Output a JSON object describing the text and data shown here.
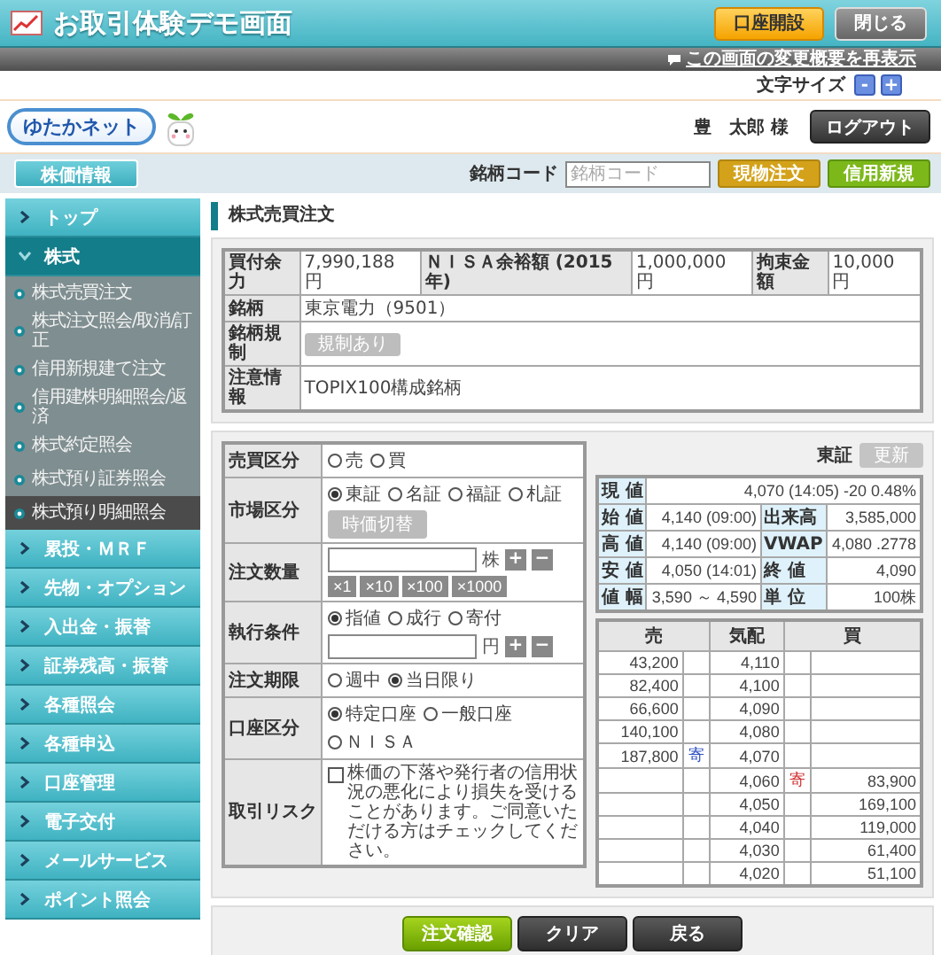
{
  "window": {
    "title": "お取引体験デモ画面",
    "buttons": [
      {
        "label": "口座開設",
        "kind": "primary"
      },
      {
        "label": "閉じる",
        "kind": "secondary"
      }
    ]
  },
  "notice_bar": {
    "link": "この画面の変更概要を再表示"
  },
  "font_size": {
    "label": "文字サイズ",
    "buttons": [
      "-",
      "+"
    ]
  },
  "header": {
    "logo": "ゆたかネット",
    "user": "豊　太郎",
    "honorific": "様",
    "logout": "ログアウト"
  },
  "toolbar": {
    "stock_info": "株価情報",
    "code_label": "銘柄コード",
    "code_placeholder": "銘柄コード",
    "buttons": [
      {
        "label": "現物注文",
        "kind": "spot"
      },
      {
        "label": "信用新規",
        "kind": "margin"
      }
    ]
  },
  "sidebar": {
    "items": [
      {
        "label": "トップ",
        "expanded": false
      },
      {
        "label": "株式",
        "expanded": true,
        "children": [
          {
            "label": "株式売買注文",
            "selected": false
          },
          {
            "label": "株式注文照会/取消/訂正",
            "selected": false
          },
          {
            "label": "信用新規建て注文",
            "selected": false
          },
          {
            "label": "信用建株明細照会/返済",
            "selected": false
          },
          {
            "label": "株式約定照会",
            "selected": false
          },
          {
            "label": "株式預り証券照会",
            "selected": false
          },
          {
            "label": "株式預り明細照会",
            "selected": true
          }
        ]
      },
      {
        "label": "累投・ＭＲＦ",
        "expanded": false
      },
      {
        "label": "先物・オプション",
        "expanded": false
      },
      {
        "label": "入出金・振替",
        "expanded": false
      },
      {
        "label": "証券残高・振替",
        "expanded": false
      },
      {
        "label": "各種照会",
        "expanded": false
      },
      {
        "label": "各種申込",
        "expanded": false
      },
      {
        "label": "口座管理",
        "expanded": false
      },
      {
        "label": "電子交付",
        "expanded": false
      },
      {
        "label": "メールサービス",
        "expanded": false
      },
      {
        "label": "ポイント照会",
        "expanded": false
      }
    ]
  },
  "main": {
    "heading": "株式売買注文",
    "account": {
      "cells": [
        {
          "label": "買付余力",
          "value": "7,990,188 円"
        },
        {
          "label": "ＮＩＳＡ余裕額 (2015年)",
          "value": "1,000,000 円"
        },
        {
          "label": "拘束金額",
          "value": "10,000 円"
        }
      ],
      "rows": [
        {
          "label": "銘柄",
          "kind": "text",
          "value": "東京電力（9501）"
        },
        {
          "label": "銘柄規制",
          "kind": "badge",
          "value": "規制あり"
        },
        {
          "label": "注意情報",
          "kind": "text",
          "value": "TOPIX100構成銘柄"
        }
      ]
    },
    "order_form": {
      "rows": [
        {
          "label": "売買区分",
          "parts": [
            {
              "kind": "radio",
              "options": [
                {
                  "label": "売",
                  "selected": false
                },
                {
                  "label": "買",
                  "selected": false
                }
              ]
            }
          ]
        },
        {
          "label": "市場区分",
          "parts": [
            {
              "kind": "radio",
              "options": [
                {
                  "label": "東証",
                  "selected": true
                },
                {
                  "label": "名証",
                  "selected": false
                },
                {
                  "label": "福証",
                  "selected": false
                },
                {
                  "label": "札証",
                  "selected": false
                }
              ]
            },
            {
              "kind": "button",
              "label": "時価切替"
            }
          ]
        },
        {
          "label": "注文数量",
          "parts": [
            {
              "kind": "input",
              "unit": "株",
              "steppers": [
                "+",
                "−"
              ]
            },
            {
              "kind": "multipliers",
              "items": [
                "×1",
                "×10",
                "×100",
                "×1000"
              ]
            }
          ]
        },
        {
          "label": "執行条件",
          "parts": [
            {
              "kind": "radio",
              "options": [
                {
                  "label": "指値",
                  "selected": true
                },
                {
                  "label": "成行",
                  "selected": false
                },
                {
                  "label": "寄付",
                  "selected": false
                }
              ]
            },
            {
              "kind": "input",
              "unit": "円",
              "steppers": [
                "+",
                "−"
              ]
            }
          ]
        },
        {
          "label": "注文期限",
          "parts": [
            {
              "kind": "radio",
              "options": [
                {
                  "label": "週中",
                  "selected": false
                },
                {
                  "label": "当日限り",
                  "selected": true
                }
              ]
            }
          ]
        },
        {
          "label": "口座区分",
          "parts": [
            {
              "kind": "radio",
              "options": [
                {
                  "label": "特定口座",
                  "selected": true
                },
                {
                  "label": "一般口座",
                  "selected": false
                },
                {
                  "label": "ＮＩＳＡ",
                  "selected": false
                }
              ]
            }
          ]
        },
        {
          "label": "取引リスク",
          "parts": [
            {
              "kind": "checkbox",
              "checked": false,
              "text": "株価の下落や発行者の信用状況の悪化により損失を受けることがあります。ご同意いただける方はチェックしてください。"
            }
          ]
        }
      ]
    },
    "quote": {
      "market": "東証",
      "refresh": {
        "label": "更新",
        "disabled": true
      },
      "current": {
        "label": "現 値",
        "value": "4,070 (14:05) -20 0.48%"
      },
      "stats": [
        {
          "label": "始 値",
          "value": "4,140 (09:00)",
          "label_2": "出来高",
          "value_2": "3,585,000"
        },
        {
          "label": "高 値",
          "value": "4,140 (09:00)",
          "label_2": "VWAP",
          "value_2": "4,080 .2778"
        },
        {
          "label": "安 値",
          "value": "4,050 (14:01)",
          "label_2": "終 値",
          "value_2": "4,090"
        },
        {
          "label": "値 幅",
          "value": "3,590 ～ 4,590",
          "label_2": "単 位",
          "value_2": "100株"
        }
      ]
    },
    "board": {
      "columns": [
        "売",
        "気配",
        "買"
      ],
      "rows": [
        {
          "sell": "43,200",
          "price": "4,110"
        },
        {
          "sell": "82,400",
          "price": "4,100"
        },
        {
          "sell": "66,600",
          "price": "4,090"
        },
        {
          "sell": "140,100",
          "price": "4,080"
        },
        {
          "sell": "187,800",
          "sell_mark": "寄",
          "price": "4,070"
        },
        {
          "price": "4,060",
          "buy_mark": "寄",
          "buy": "83,900"
        },
        {
          "price": "4,050",
          "buy": "169,100"
        },
        {
          "price": "4,040",
          "buy": "119,000"
        },
        {
          "price": "4,030",
          "buy": "61,400"
        },
        {
          "price": "4,020",
          "buy": "51,100"
        }
      ]
    },
    "actions": [
      {
        "label": "注文確認",
        "kind": "confirm"
      },
      {
        "label": "クリア",
        "kind": "neutral"
      },
      {
        "label": "戻る",
        "kind": "neutral"
      }
    ]
  }
}
